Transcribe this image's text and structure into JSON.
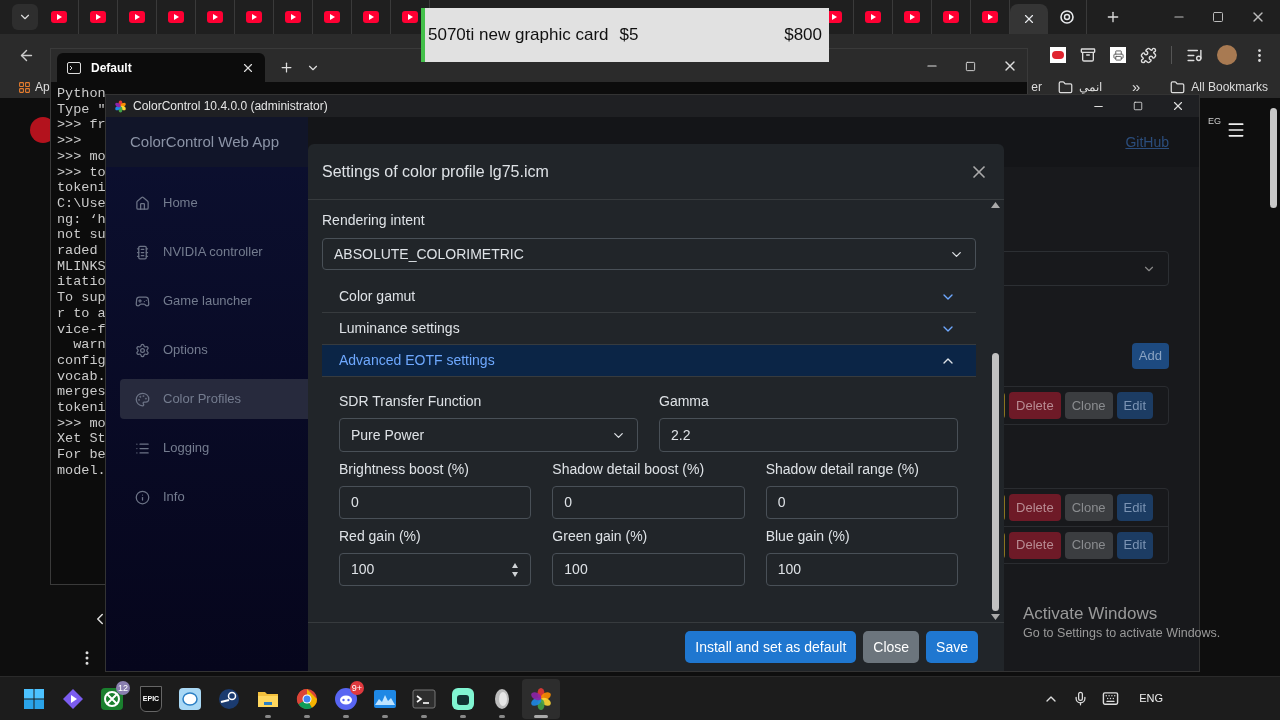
{
  "browser": {
    "tab_groups": [
      [
        {
          "kind": "video",
          "selected": false
        },
        {
          "kind": "video",
          "selected": false
        },
        {
          "kind": "video",
          "selected": false
        },
        {
          "kind": "video",
          "selected": false
        },
        {
          "kind": "video",
          "selected": false
        },
        {
          "kind": "video",
          "selected": false
        },
        {
          "kind": "video",
          "selected": false
        },
        {
          "kind": "video",
          "selected": false
        },
        {
          "kind": "video",
          "selected": false
        },
        {
          "kind": "video",
          "selected": false
        }
      ],
      [
        {
          "kind": "video",
          "selected": false
        },
        {
          "kind": "video",
          "selected": false
        },
        {
          "kind": "video",
          "selected": false
        },
        {
          "kind": "video",
          "selected": false
        },
        {
          "kind": "video",
          "selected": false
        },
        {
          "kind": "blank",
          "selected": true
        },
        {
          "kind": "knot",
          "selected": false
        }
      ]
    ],
    "bookmarks_left": [
      {
        "kind": "apps",
        "label": "Ap"
      }
    ],
    "bookmarks_right": [
      {
        "kind": "text",
        "label": "er"
      },
      {
        "kind": "folder",
        "label": "انمي"
      },
      {
        "kind": "overflow",
        "label": "»"
      },
      {
        "kind": "folder",
        "label": "All Bookmarks"
      }
    ],
    "page_corner_text": "EG"
  },
  "terminal": {
    "tab_title": "Default",
    "lines": [
      "Python",
      "Type \"",
      ">>> fr",
      ">>>",
      ">>> mo",
      ">>> to",
      "tokeni",
      "C:\\Use",
      "ng: ‘h",
      "not su",
      "raded",
      "MLINKS",
      "itatio",
      "To sup",
      "r to a",
      "vice-f",
      "  warn",
      "config",
      "vocab.",
      "merges",
      "tokeni",
      ">>> mo",
      "Xet St",
      "For be",
      "model."
    ]
  },
  "app": {
    "title": "ColorControl 10.4.0.0 (administrator)",
    "app_name": "ColorControl Web App",
    "nav": [
      {
        "label": "Home",
        "kind": "home",
        "selected": false
      },
      {
        "label": "NVIDIA controller",
        "kind": "chip",
        "selected": false
      },
      {
        "label": "Game launcher",
        "kind": "gamepad",
        "selected": false
      },
      {
        "label": "Options",
        "kind": "gear",
        "selected": false
      },
      {
        "label": "Color Profiles",
        "kind": "palette",
        "selected": true
      },
      {
        "label": "Logging",
        "kind": "list",
        "selected": false
      },
      {
        "label": "Info",
        "kind": "info",
        "selected": false
      }
    ],
    "github_link": "GitHub",
    "add_button": "Add",
    "profile_cards": [
      [
        [
          "Delete",
          "Clone",
          "Edit"
        ]
      ],
      [
        [
          "Delete",
          "Clone",
          "Edit"
        ],
        [
          "Delete",
          "Clone",
          "Edit"
        ]
      ]
    ],
    "modal": {
      "title": "Settings of color profile lg75.icm",
      "rendering_intent": {
        "label": "Rendering intent",
        "value": "ABSOLUTE_COLORIMETRIC"
      },
      "sections": [
        {
          "title": "Color gamut",
          "expanded": false
        },
        {
          "title": "Luminance settings",
          "expanded": false
        },
        {
          "title": "Advanced EOTF settings",
          "expanded": true
        }
      ],
      "eotf_rows": [
        [
          {
            "label": "SDR Transfer Function",
            "value": "Pure Power",
            "kind": "select"
          },
          {
            "label": "Gamma",
            "value": "2.2",
            "kind": "text"
          }
        ],
        [
          {
            "label": "Brightness boost (%)",
            "value": "0",
            "kind": "text"
          },
          {
            "label": "Shadow detail boost (%)",
            "value": "0",
            "kind": "text"
          },
          {
            "label": "Shadow detail range (%)",
            "value": "0",
            "kind": "text"
          }
        ],
        [
          {
            "label": "Red gain (%)",
            "value": "100",
            "kind": "number"
          },
          {
            "label": "Green gain (%)",
            "value": "100",
            "kind": "text"
          },
          {
            "label": "Blue gain (%)",
            "value": "100",
            "kind": "text"
          }
        ]
      ],
      "buttons": [
        {
          "label": "Install and set as default",
          "kind": "primary"
        },
        {
          "label": "Close",
          "kind": "secondary"
        },
        {
          "label": "Save",
          "kind": "primary"
        }
      ]
    }
  },
  "activation": {
    "title": "Activate Windows",
    "subtitle": "Go to Settings to activate Windows."
  },
  "overlay": {
    "title": "5070ti new graphic card",
    "raised": "$5",
    "goal": "$800"
  },
  "taskbar": {
    "apps": [
      {
        "kind": "windows",
        "running": false,
        "selected": false
      },
      {
        "kind": "play",
        "running": false,
        "selected": false
      },
      {
        "kind": "xbox",
        "running": false,
        "selected": false,
        "badge": "12"
      },
      {
        "kind": "epic",
        "running": false,
        "selected": false,
        "label": "EPIC"
      },
      {
        "kind": "chat",
        "running": false,
        "selected": false
      },
      {
        "kind": "steam",
        "running": false,
        "selected": false
      },
      {
        "kind": "folder",
        "running": true,
        "selected": false
      },
      {
        "kind": "browser",
        "running": true,
        "selected": false
      },
      {
        "kind": "discord",
        "running": true,
        "selected": false,
        "badge": "9+"
      },
      {
        "kind": "monitor",
        "running": true,
        "selected": false
      },
      {
        "kind": "terminal",
        "running": true,
        "selected": false
      },
      {
        "kind": "stream",
        "running": true,
        "selected": false
      },
      {
        "kind": "speaker",
        "running": true,
        "selected": false
      },
      {
        "kind": "colorwheel",
        "running": true,
        "selected": true
      }
    ],
    "language": "ENG"
  }
}
